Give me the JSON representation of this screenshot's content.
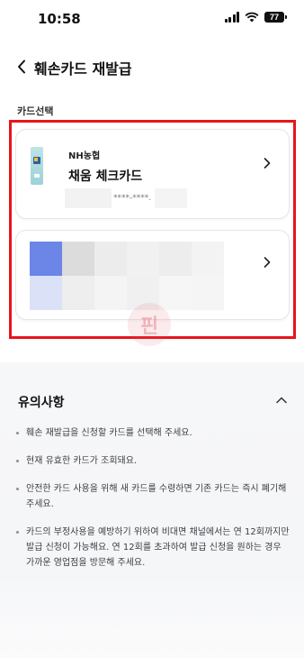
{
  "status": {
    "time": "10:58",
    "battery": "77"
  },
  "header": {
    "title": "훼손카드 재발급"
  },
  "section_label": "카드선택",
  "card": {
    "bank": "NH농협",
    "name": "채움 체크카드",
    "masked_number": "****-****."
  },
  "notice": {
    "title": "유의사항",
    "items": [
      "훼손 재발급을 신청할 카드를 선택해 주세요.",
      "현재 유효한 카드가 조회돼요.",
      "안전한 카드 사용을 위해 새 카드를 수령하면 기존 카드는 즉시 폐기해 주세요.",
      "카드의 부정사용을 예방하기 위하여 비대면 채널에서는 연 12회까지만 발급 신청이 가능해요. 연 12회를 초과하여 발급 신청을 원하는 경우 가까운 영업점을 방문해 주세요."
    ]
  },
  "watermark_text": "핀",
  "colors": {
    "highlight": "#e8141c",
    "notice_bg": "#f6f7f9"
  },
  "icons": [
    "back-chevron-icon",
    "chevron-right-icon",
    "chevron-up-icon",
    "signal-icon",
    "wifi-icon",
    "battery-icon"
  ]
}
